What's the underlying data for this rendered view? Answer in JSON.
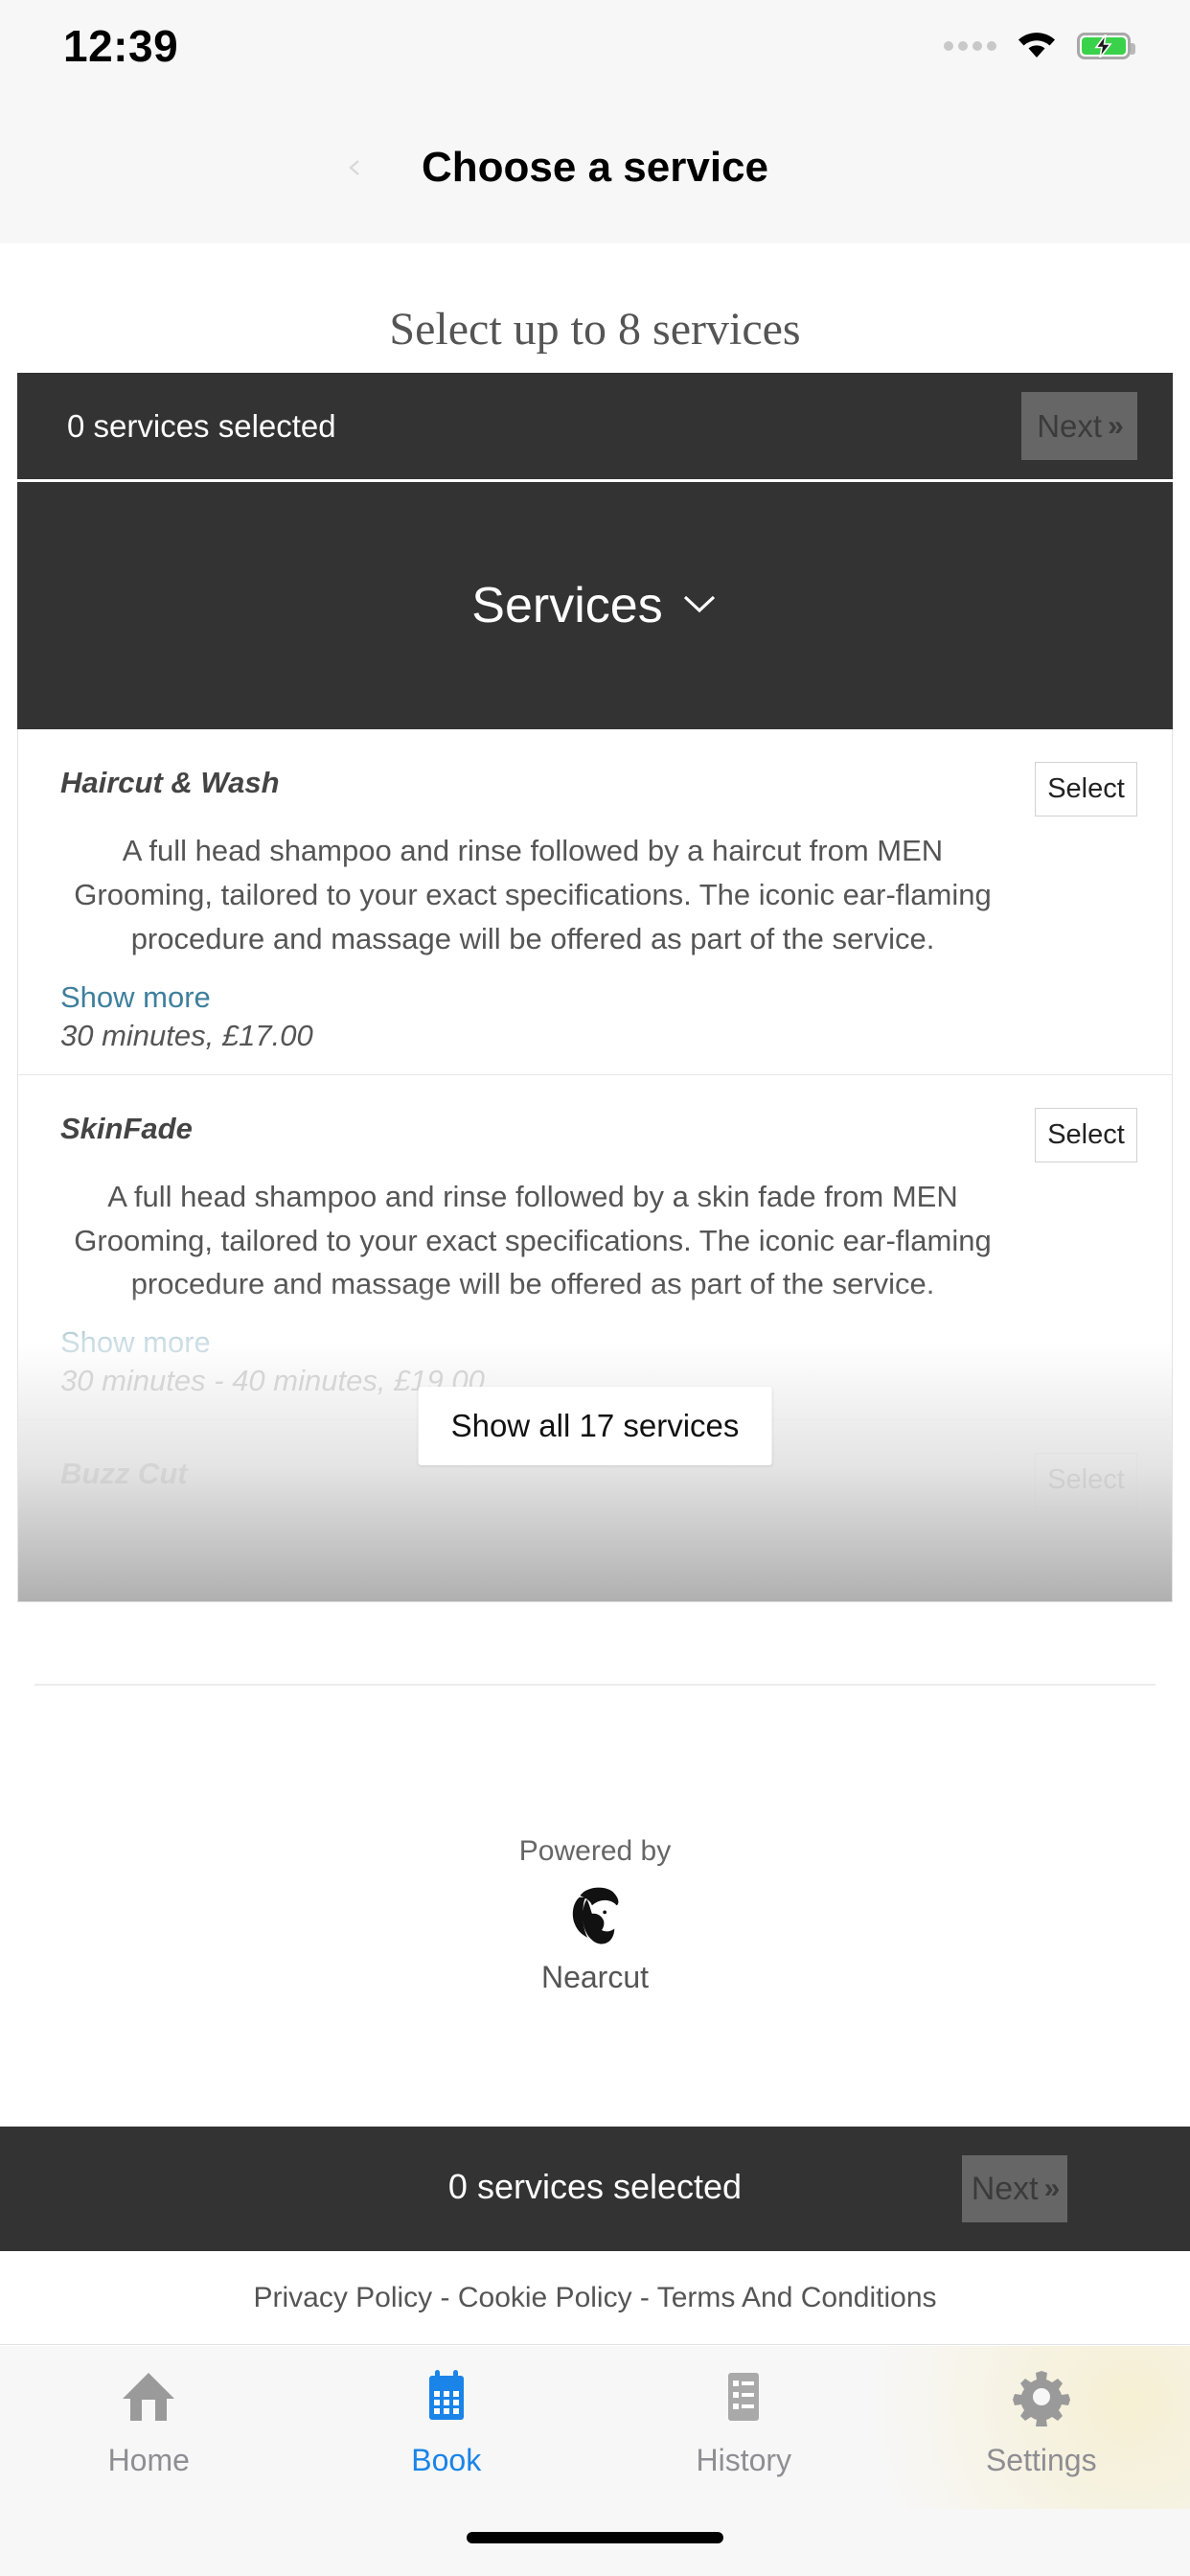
{
  "status_bar": {
    "time": "12:39",
    "signal_icon": "signal-dots-icon",
    "wifi_icon": "wifi-icon",
    "battery_icon": "battery-charging-icon",
    "battery_color": "#3ad24a"
  },
  "navbar": {
    "title": "Choose a service",
    "back_icon": "chevron-left-icon"
  },
  "page": {
    "subtitle": "Select up to 8 services"
  },
  "selection_bar_top": {
    "count_label": "0 services selected",
    "next_label": "Next",
    "next_chevron": "»",
    "next_enabled": false,
    "bar_color": "#333333",
    "button_color": "#666666"
  },
  "services_section": {
    "header_label": "Services",
    "caret_icon": "chevron-down-icon",
    "show_all_label": "Show all 17 services",
    "total_services": 17,
    "items": [
      {
        "name": "Haircut & Wash",
        "description": "A full head shampoo and rinse followed by a haircut from MEN Grooming, tailored to your exact specifications. The iconic ear-flaming procedure and massage will be offered as part of the service.",
        "show_more_label": "Show more",
        "price_line": "30 minutes, £17.00",
        "select_label": "Select"
      },
      {
        "name": "SkinFade",
        "description": "A full head shampoo and rinse followed by a skin fade from MEN Grooming, tailored to your exact specifications. The iconic ear-flaming procedure and massage will be offered as part of the service.",
        "show_more_label": "Show more",
        "price_line": "30 minutes - 40 minutes, £19.00",
        "select_label": "Select"
      },
      {
        "name": "Buzz Cut",
        "description": "",
        "show_more_label": "",
        "price_line": "",
        "select_label": "Select"
      }
    ]
  },
  "powered_by": {
    "label": "Powered by",
    "logo_icon": "bearded-man-logo-icon",
    "brand": "Nearcut"
  },
  "selection_bar_bottom": {
    "count_label": "0 services selected",
    "next_label": "Next",
    "next_chevron": "»",
    "next_enabled": false
  },
  "legal_footer": {
    "text": "Privacy Policy - Cookie Policy - Terms And Conditions"
  },
  "tab_bar": {
    "active_color": "#1a84e8",
    "inactive_color": "#8e8e93",
    "tabs": [
      {
        "label": "Home",
        "icon": "home-icon",
        "active": false
      },
      {
        "label": "Book",
        "icon": "calendar-icon",
        "active": true
      },
      {
        "label": "History",
        "icon": "list-icon",
        "active": false
      },
      {
        "label": "Settings",
        "icon": "gear-icon",
        "active": false
      }
    ]
  }
}
